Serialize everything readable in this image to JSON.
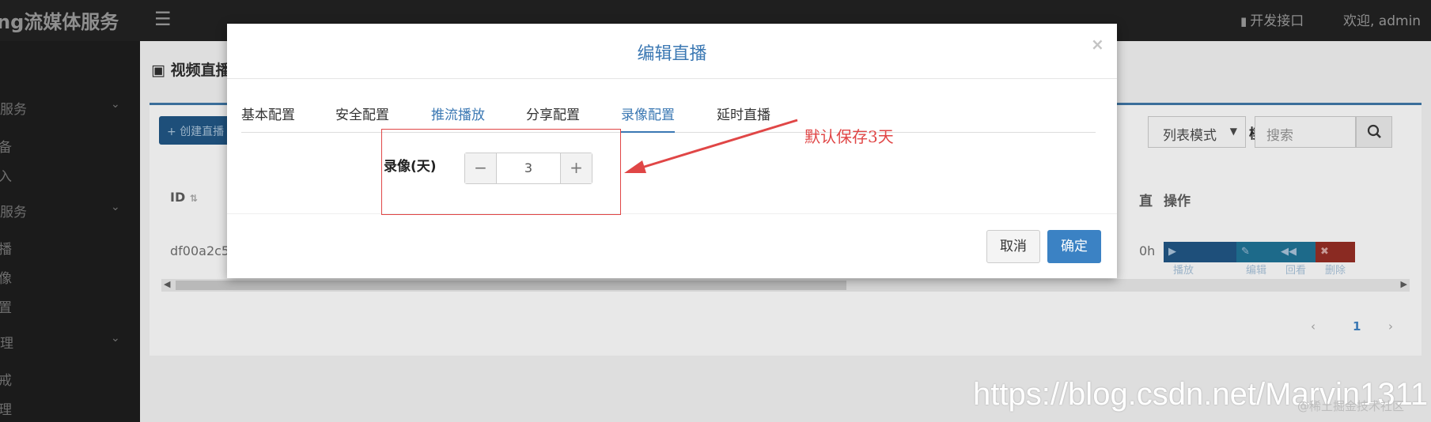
{
  "app": {
    "brand": "ng流媒体服务",
    "header_links": {
      "api": "开发接口",
      "welcome": "欢迎, admin"
    }
  },
  "sidebar": {
    "items": [
      {
        "label": "服务"
      },
      {
        "label": "备"
      },
      {
        "label": "入"
      },
      {
        "label": "服务"
      },
      {
        "label": "播"
      },
      {
        "label": "像"
      },
      {
        "label": "置"
      },
      {
        "label": "理"
      },
      {
        "label": "戒"
      },
      {
        "label": "理"
      }
    ]
  },
  "page": {
    "title": "视频直播",
    "create_button": "创建直播",
    "mode_label": "模式",
    "mode_select_value": "列表模式",
    "search_placeholder": "搜索",
    "table": {
      "headers": {
        "id": "ID",
        "live": "直",
        "ops": "操作"
      },
      "row": {
        "id": "df00a2c5",
        "live": "0h",
        "actions": {
          "play": "播放",
          "edit": "编辑",
          "replay": "回看",
          "delete": "删除"
        }
      }
    },
    "pagination": {
      "current": "1"
    }
  },
  "modal": {
    "title": "编辑直播",
    "close": "×",
    "tabs": [
      {
        "label": "基本配置",
        "state": "normal"
      },
      {
        "label": "安全配置",
        "state": "normal"
      },
      {
        "label": "推流播放",
        "state": "link"
      },
      {
        "label": "分享配置",
        "state": "normal"
      },
      {
        "label": "录像配置",
        "state": "active"
      },
      {
        "label": "延时直播",
        "state": "normal"
      }
    ],
    "record_days": {
      "label": "录像(天)",
      "value": "3",
      "minus": "−",
      "plus": "+"
    },
    "footer": {
      "cancel": "取消",
      "confirm": "确定"
    }
  },
  "annotation": {
    "text": "默认保存3天",
    "color": "#e04646"
  },
  "watermark": {
    "url": "https://blog.csdn.net/Marvin1311",
    "corner": "@稀土掘金技术社区"
  },
  "colors": {
    "accent": "#3b78b3",
    "primary_button": "#3b82c4",
    "topbar": "#1f1f1f"
  }
}
